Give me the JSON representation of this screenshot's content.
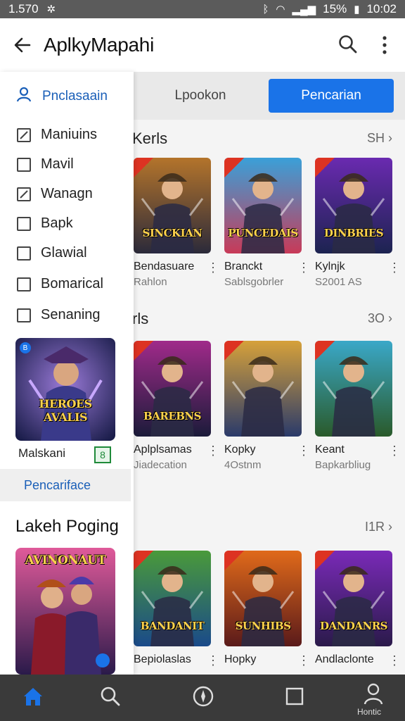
{
  "status": {
    "time_left": "1.570",
    "battery": "15%",
    "time_right": "10:02"
  },
  "appbar": {
    "title": "AplkyMapahi"
  },
  "tabs": [
    {
      "label": "Lpookon"
    },
    {
      "label": "Pencarian"
    }
  ],
  "drawer": {
    "header": "Pnclasaain",
    "items": [
      {
        "label": "Maniuins",
        "checked": true
      },
      {
        "label": "Mavil",
        "checked": false
      },
      {
        "label": "Wanagn",
        "checked": true
      },
      {
        "label": "Bapk",
        "checked": false
      },
      {
        "label": "Glawial",
        "checked": false
      },
      {
        "label": "Bomarical",
        "checked": false
      },
      {
        "label": "Senaning",
        "checked": false
      }
    ],
    "promo": {
      "art_text": "HEROES AVALIS",
      "name": "Malskani",
      "badge": "8"
    },
    "link": "Pencariface",
    "section": "Lakeh Poging",
    "section_card_text": "AVINONAUT"
  },
  "sections": [
    {
      "title": "Kerls",
      "more": "SH",
      "cards": [
        {
          "title": "Bendasuare",
          "sub": "Rahlon",
          "art_text": "SINCKIAN",
          "colors": [
            "#b4742b",
            "#2b2a3a"
          ]
        },
        {
          "title": "Branckt",
          "sub": "Sablsgobrler",
          "art_text": "PUNCEDAIS",
          "colors": [
            "#3aa0d8",
            "#c83a58"
          ]
        },
        {
          "title": "Kylnjk",
          "sub": "S2001 AS",
          "art_text": "DINBRIES",
          "colors": [
            "#6a2ab0",
            "#1c2350"
          ]
        }
      ]
    },
    {
      "title": "rls",
      "more": "3O",
      "cards": [
        {
          "title": "Aplplsamas",
          "sub": "Jiadecation",
          "art_text": "BAREBNS",
          "colors": [
            "#a02a8a",
            "#1b1b3a"
          ]
        },
        {
          "title": "Kopky",
          "sub": "4Ostnm",
          "art_text": "",
          "colors": [
            "#d6a13a",
            "#2a3a6a"
          ]
        },
        {
          "title": "Keant",
          "sub": "Bapkarbliug",
          "art_text": "",
          "colors": [
            "#3aa8c8",
            "#2a5a2a"
          ]
        }
      ]
    },
    {
      "title": "",
      "more": "I1R",
      "cards": [
        {
          "title": "Bepiolaslas",
          "sub": "",
          "art_text": "BANDANIT",
          "colors": [
            "#4a9a3a",
            "#1a4a8a"
          ]
        },
        {
          "title": "Hopky",
          "sub": "",
          "art_text": "SUNHIBS",
          "colors": [
            "#e06a1a",
            "#5a1a1a"
          ]
        },
        {
          "title": "Andlaclonte",
          "sub": "",
          "art_text": "DANDANRS",
          "colors": [
            "#7a2ab8",
            "#2a1a4a"
          ]
        }
      ]
    }
  ],
  "bottomnav": {
    "profile_label": "Hontic"
  }
}
